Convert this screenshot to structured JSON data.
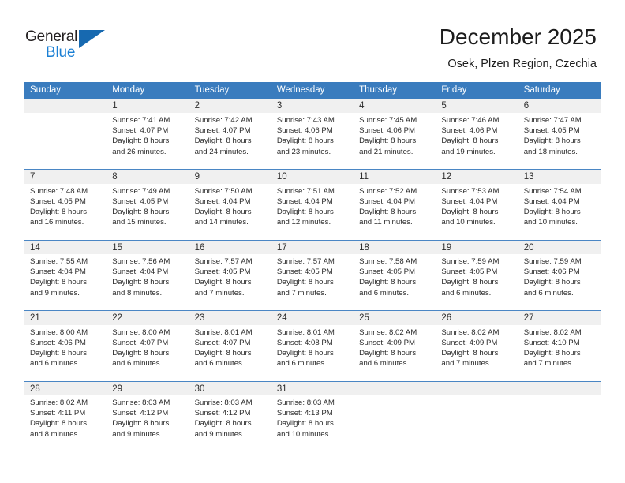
{
  "brand": {
    "name_part1": "General",
    "name_part2": "Blue",
    "triangle_color": "#1769b0",
    "blue_color": "#1a7fd4"
  },
  "header": {
    "title": "December 2025",
    "subtitle": "Osek, Plzen Region, Czechia",
    "header_bg": "#3a7cbe",
    "daynum_bg": "#f0f0f0",
    "separator_color": "#4a86c4"
  },
  "calendar": {
    "weekday_headers": [
      "Sunday",
      "Monday",
      "Tuesday",
      "Wednesday",
      "Thursday",
      "Friday",
      "Saturday"
    ],
    "weeks": [
      {
        "days": [
          {
            "num": "",
            "l1": "",
            "l2": "",
            "l3": "",
            "l4": ""
          },
          {
            "num": "1",
            "l1": "Sunrise: 7:41 AM",
            "l2": "Sunset: 4:07 PM",
            "l3": "Daylight: 8 hours",
            "l4": "and 26 minutes."
          },
          {
            "num": "2",
            "l1": "Sunrise: 7:42 AM",
            "l2": "Sunset: 4:07 PM",
            "l3": "Daylight: 8 hours",
            "l4": "and 24 minutes."
          },
          {
            "num": "3",
            "l1": "Sunrise: 7:43 AM",
            "l2": "Sunset: 4:06 PM",
            "l3": "Daylight: 8 hours",
            "l4": "and 23 minutes."
          },
          {
            "num": "4",
            "l1": "Sunrise: 7:45 AM",
            "l2": "Sunset: 4:06 PM",
            "l3": "Daylight: 8 hours",
            "l4": "and 21 minutes."
          },
          {
            "num": "5",
            "l1": "Sunrise: 7:46 AM",
            "l2": "Sunset: 4:06 PM",
            "l3": "Daylight: 8 hours",
            "l4": "and 19 minutes."
          },
          {
            "num": "6",
            "l1": "Sunrise: 7:47 AM",
            "l2": "Sunset: 4:05 PM",
            "l3": "Daylight: 8 hours",
            "l4": "and 18 minutes."
          }
        ]
      },
      {
        "days": [
          {
            "num": "7",
            "l1": "Sunrise: 7:48 AM",
            "l2": "Sunset: 4:05 PM",
            "l3": "Daylight: 8 hours",
            "l4": "and 16 minutes."
          },
          {
            "num": "8",
            "l1": "Sunrise: 7:49 AM",
            "l2": "Sunset: 4:05 PM",
            "l3": "Daylight: 8 hours",
            "l4": "and 15 minutes."
          },
          {
            "num": "9",
            "l1": "Sunrise: 7:50 AM",
            "l2": "Sunset: 4:04 PM",
            "l3": "Daylight: 8 hours",
            "l4": "and 14 minutes."
          },
          {
            "num": "10",
            "l1": "Sunrise: 7:51 AM",
            "l2": "Sunset: 4:04 PM",
            "l3": "Daylight: 8 hours",
            "l4": "and 12 minutes."
          },
          {
            "num": "11",
            "l1": "Sunrise: 7:52 AM",
            "l2": "Sunset: 4:04 PM",
            "l3": "Daylight: 8 hours",
            "l4": "and 11 minutes."
          },
          {
            "num": "12",
            "l1": "Sunrise: 7:53 AM",
            "l2": "Sunset: 4:04 PM",
            "l3": "Daylight: 8 hours",
            "l4": "and 10 minutes."
          },
          {
            "num": "13",
            "l1": "Sunrise: 7:54 AM",
            "l2": "Sunset: 4:04 PM",
            "l3": "Daylight: 8 hours",
            "l4": "and 10 minutes."
          }
        ]
      },
      {
        "days": [
          {
            "num": "14",
            "l1": "Sunrise: 7:55 AM",
            "l2": "Sunset: 4:04 PM",
            "l3": "Daylight: 8 hours",
            "l4": "and 9 minutes."
          },
          {
            "num": "15",
            "l1": "Sunrise: 7:56 AM",
            "l2": "Sunset: 4:04 PM",
            "l3": "Daylight: 8 hours",
            "l4": "and 8 minutes."
          },
          {
            "num": "16",
            "l1": "Sunrise: 7:57 AM",
            "l2": "Sunset: 4:05 PM",
            "l3": "Daylight: 8 hours",
            "l4": "and 7 minutes."
          },
          {
            "num": "17",
            "l1": "Sunrise: 7:57 AM",
            "l2": "Sunset: 4:05 PM",
            "l3": "Daylight: 8 hours",
            "l4": "and 7 minutes."
          },
          {
            "num": "18",
            "l1": "Sunrise: 7:58 AM",
            "l2": "Sunset: 4:05 PM",
            "l3": "Daylight: 8 hours",
            "l4": "and 6 minutes."
          },
          {
            "num": "19",
            "l1": "Sunrise: 7:59 AM",
            "l2": "Sunset: 4:05 PM",
            "l3": "Daylight: 8 hours",
            "l4": "and 6 minutes."
          },
          {
            "num": "20",
            "l1": "Sunrise: 7:59 AM",
            "l2": "Sunset: 4:06 PM",
            "l3": "Daylight: 8 hours",
            "l4": "and 6 minutes."
          }
        ]
      },
      {
        "days": [
          {
            "num": "21",
            "l1": "Sunrise: 8:00 AM",
            "l2": "Sunset: 4:06 PM",
            "l3": "Daylight: 8 hours",
            "l4": "and 6 minutes."
          },
          {
            "num": "22",
            "l1": "Sunrise: 8:00 AM",
            "l2": "Sunset: 4:07 PM",
            "l3": "Daylight: 8 hours",
            "l4": "and 6 minutes."
          },
          {
            "num": "23",
            "l1": "Sunrise: 8:01 AM",
            "l2": "Sunset: 4:07 PM",
            "l3": "Daylight: 8 hours",
            "l4": "and 6 minutes."
          },
          {
            "num": "24",
            "l1": "Sunrise: 8:01 AM",
            "l2": "Sunset: 4:08 PM",
            "l3": "Daylight: 8 hours",
            "l4": "and 6 minutes."
          },
          {
            "num": "25",
            "l1": "Sunrise: 8:02 AM",
            "l2": "Sunset: 4:09 PM",
            "l3": "Daylight: 8 hours",
            "l4": "and 6 minutes."
          },
          {
            "num": "26",
            "l1": "Sunrise: 8:02 AM",
            "l2": "Sunset: 4:09 PM",
            "l3": "Daylight: 8 hours",
            "l4": "and 7 minutes."
          },
          {
            "num": "27",
            "l1": "Sunrise: 8:02 AM",
            "l2": "Sunset: 4:10 PM",
            "l3": "Daylight: 8 hours",
            "l4": "and 7 minutes."
          }
        ]
      },
      {
        "days": [
          {
            "num": "28",
            "l1": "Sunrise: 8:02 AM",
            "l2": "Sunset: 4:11 PM",
            "l3": "Daylight: 8 hours",
            "l4": "and 8 minutes."
          },
          {
            "num": "29",
            "l1": "Sunrise: 8:03 AM",
            "l2": "Sunset: 4:12 PM",
            "l3": "Daylight: 8 hours",
            "l4": "and 9 minutes."
          },
          {
            "num": "30",
            "l1": "Sunrise: 8:03 AM",
            "l2": "Sunset: 4:12 PM",
            "l3": "Daylight: 8 hours",
            "l4": "and 9 minutes."
          },
          {
            "num": "31",
            "l1": "Sunrise: 8:03 AM",
            "l2": "Sunset: 4:13 PM",
            "l3": "Daylight: 8 hours",
            "l4": "and 10 minutes."
          },
          {
            "num": "",
            "l1": "",
            "l2": "",
            "l3": "",
            "l4": ""
          },
          {
            "num": "",
            "l1": "",
            "l2": "",
            "l3": "",
            "l4": ""
          },
          {
            "num": "",
            "l1": "",
            "l2": "",
            "l3": "",
            "l4": ""
          }
        ]
      }
    ]
  }
}
